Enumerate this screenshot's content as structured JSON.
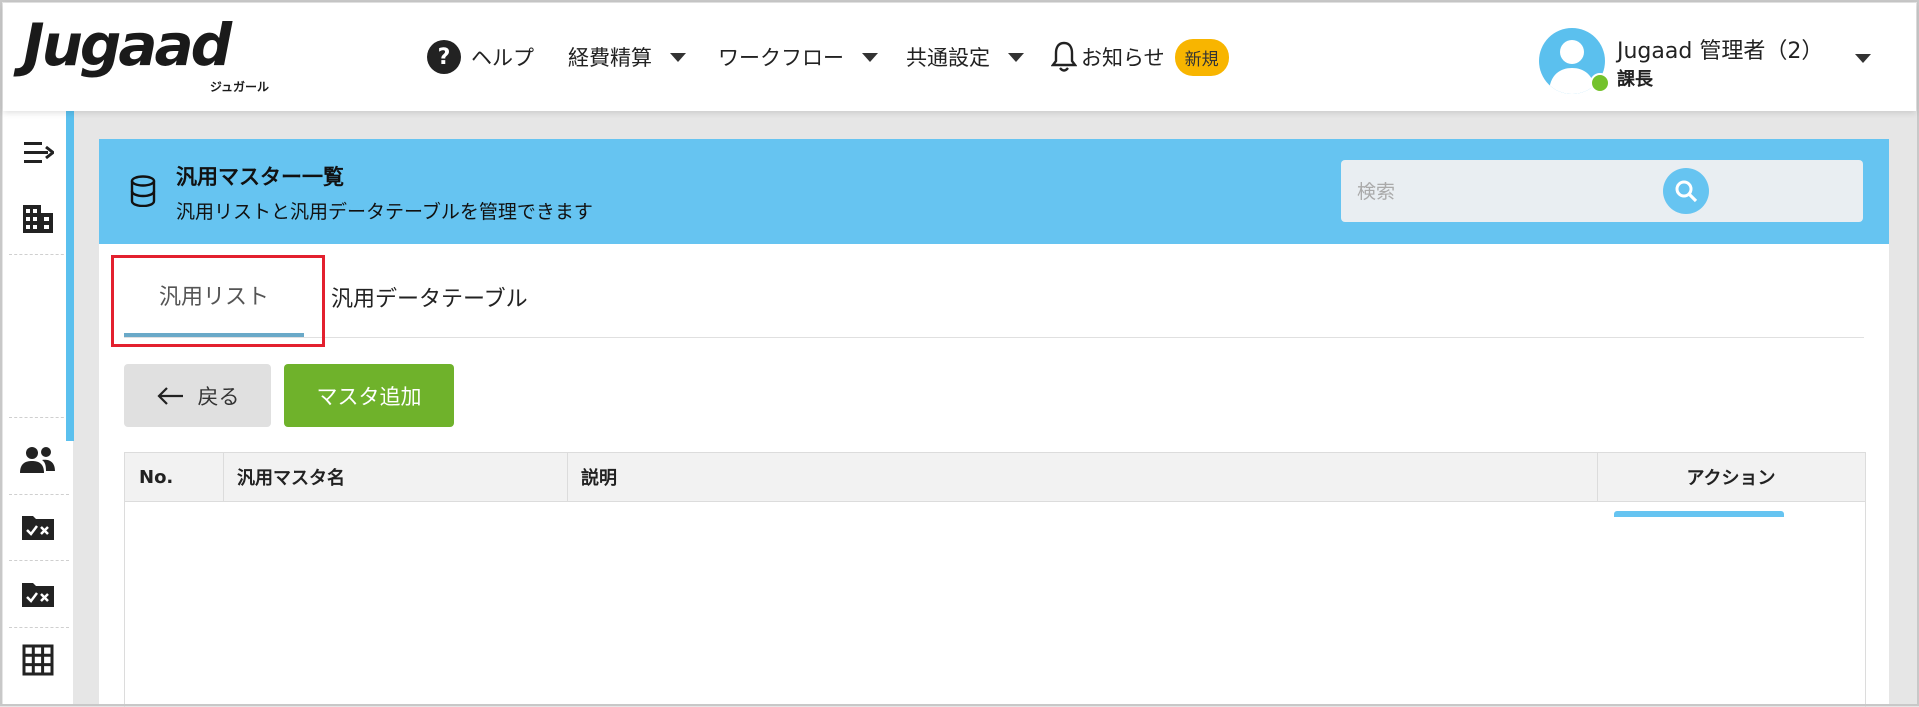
{
  "header": {
    "logo_text": "Jugaad",
    "logo_sub": "ジュガール",
    "nav": {
      "help": "ヘルプ",
      "expense": "経費精算",
      "workflow": "ワークフロー",
      "common_settings": "共通設定",
      "notifications": "お知らせ",
      "new_badge": "新規"
    },
    "user": {
      "name": "Jugaad 管理者（2）",
      "role": "課長"
    }
  },
  "sidebar": {
    "items": [
      {
        "icon": "menu-collapse-icon"
      },
      {
        "icon": "building-icon"
      },
      {
        "icon": "users-icon"
      },
      {
        "icon": "folder-check-icon"
      },
      {
        "icon": "folder-check-icon"
      },
      {
        "icon": "grid-icon"
      }
    ]
  },
  "page": {
    "title": "汎用マスター一覧",
    "subtitle": "汎用リストと汎用データテーブルを管理できます",
    "search_placeholder": "検索",
    "tabs": [
      "汎用リスト",
      "汎用データテーブル"
    ],
    "back_label": "戻る",
    "add_label": "マスタ追加"
  },
  "table": {
    "columns": [
      "No.",
      "汎用マスタ名",
      "説明",
      "アクション"
    ],
    "rows": []
  },
  "colors": {
    "accent": "#66c4f1",
    "add_button": "#6fb22b",
    "badge": "#f8b500",
    "highlight": "#e3202e"
  }
}
